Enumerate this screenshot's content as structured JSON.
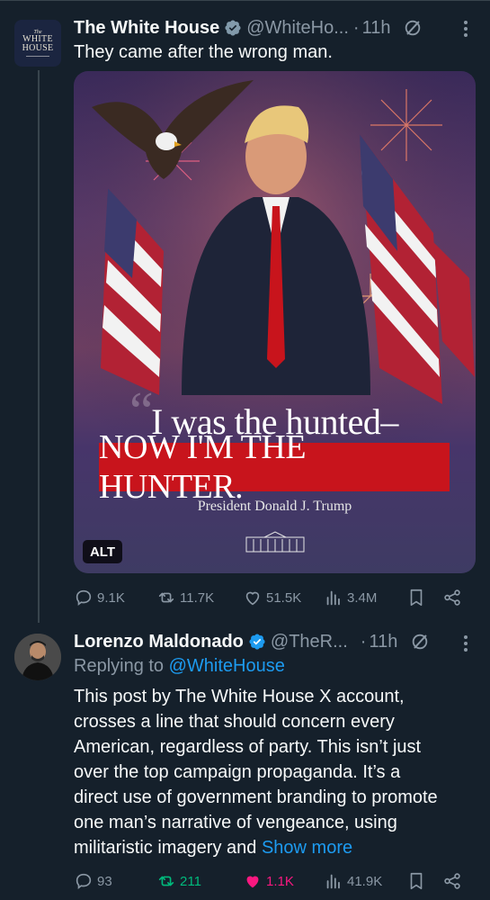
{
  "tweet1": {
    "avatar_text": {
      "small": "The",
      "line1": "WHITE",
      "line2": "HOUSE"
    },
    "name": "The White House",
    "handle": "@WhiteHo...",
    "dot": "·",
    "time": "11h",
    "text": "They came after the wrong man.",
    "media": {
      "quote_line1": "I was the hunted–",
      "quote_line2": "NOW I'M THE HUNTER.",
      "attribution": "President Donald J. Trump",
      "alt_label": "ALT"
    },
    "stats": {
      "replies": "9.1K",
      "reposts": "11.7K",
      "likes": "51.5K",
      "views": "3.4M"
    }
  },
  "tweet2": {
    "name": "Lorenzo Maldonado",
    "handle": "@TheR...",
    "dot": "·",
    "time": "11h",
    "replying_prefix": "Replying to",
    "replying_handle": "@WhiteHouse",
    "text_lines": [
      "This post by  The White House X account,",
      "crosses a line that should concern every",
      "American, regardless of party. This isn’t just",
      "over the top campaign propaganda. It’s a",
      "direct use of government branding to promote",
      "one man’s narrative of vengeance, using",
      "militaristic imagery and"
    ],
    "show_more": "Show more",
    "stats": {
      "replies": "93",
      "reposts": "211",
      "likes": "1.1K",
      "views": "41.9K"
    }
  },
  "colors": {
    "background": "#15202b",
    "accent": "#1d9bf0",
    "repost": "#00ba7c",
    "like": "#f91880",
    "muted": "#8b98a5"
  },
  "icons": [
    "verified-badge-icon",
    "grok-icon",
    "more-options-icon",
    "reply-icon",
    "repost-icon",
    "like-icon",
    "views-icon",
    "bookmark-icon",
    "share-icon"
  ]
}
